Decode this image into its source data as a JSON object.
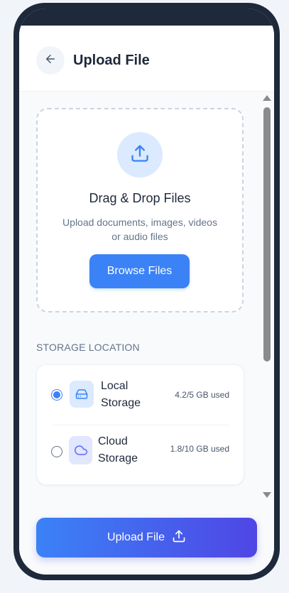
{
  "header": {
    "title": "Upload File",
    "back_icon": "arrow-left-icon"
  },
  "dropzone": {
    "icon": "upload-icon",
    "title": "Drag & Drop Files",
    "description": "Upload documents, images, videos or audio files",
    "browse_label": "Browse Files"
  },
  "storage": {
    "section_label": "STORAGE LOCATION",
    "options": [
      {
        "name": "Local Storage",
        "usage": "4.2/5 GB used",
        "icon": "hard-drive-icon",
        "selected": true
      },
      {
        "name": "Cloud Storage",
        "usage": "1.8/10 GB used",
        "icon": "cloud-icon",
        "selected": false
      }
    ]
  },
  "footer": {
    "upload_label": "Upload File",
    "upload_icon": "upload-icon"
  },
  "colors": {
    "accent": "#3b82f6",
    "accent_end": "#4f46e5",
    "frame": "#1e293b"
  }
}
